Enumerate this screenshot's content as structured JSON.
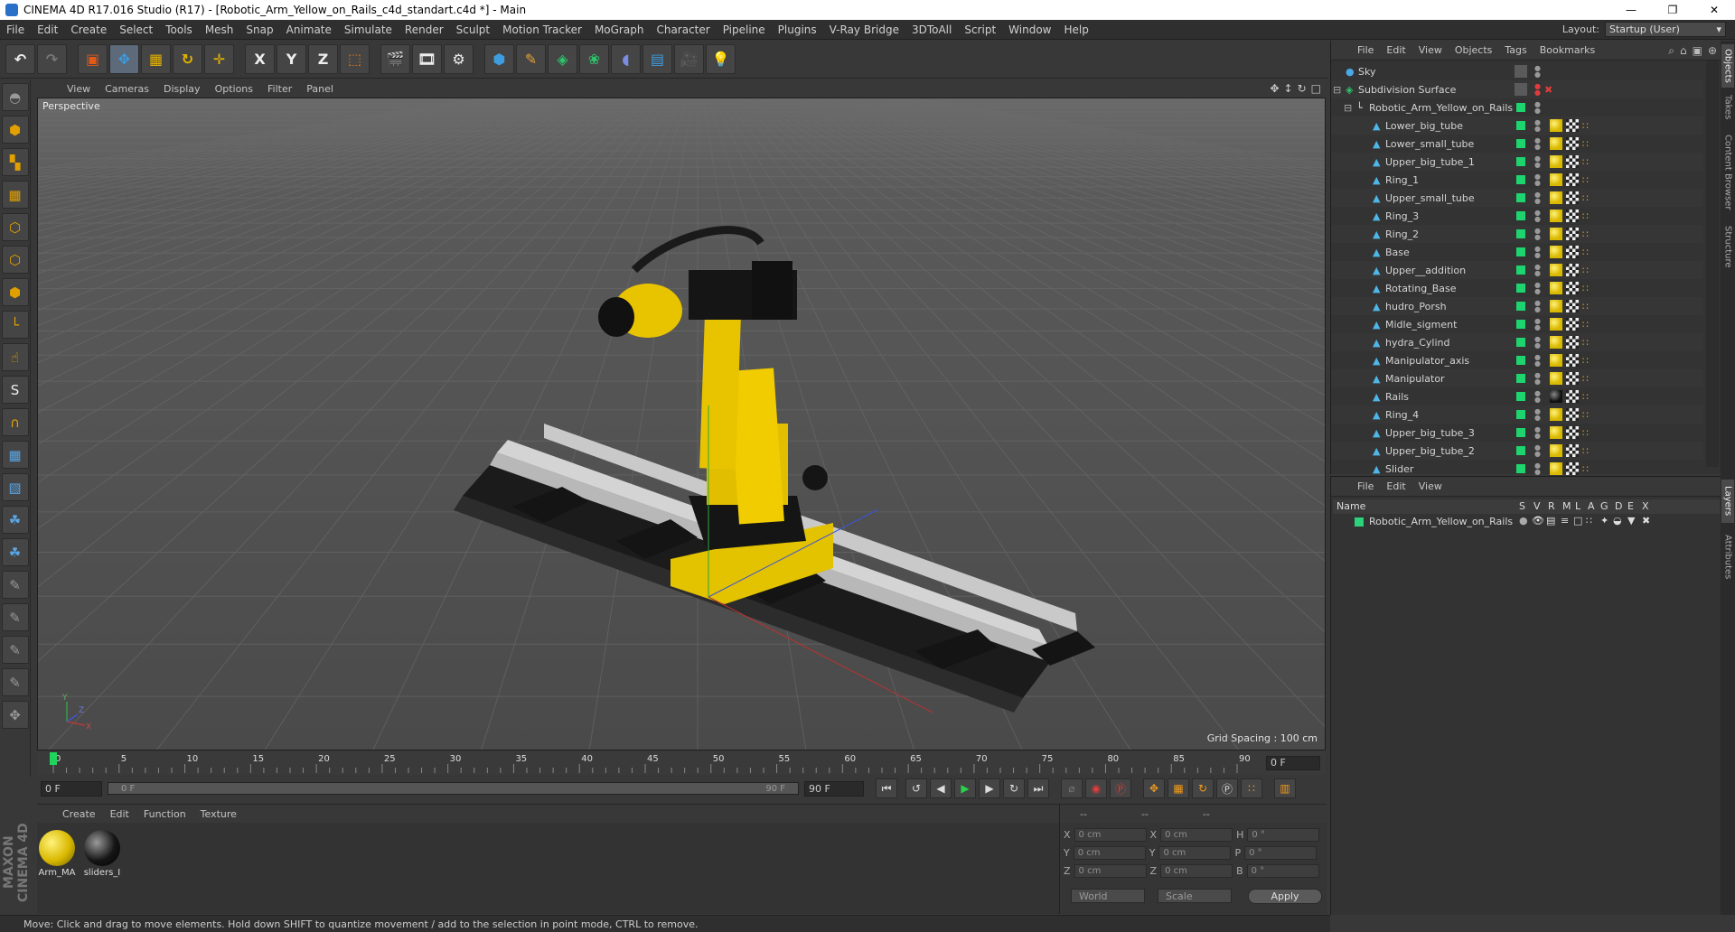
{
  "window": {
    "title": "CINEMA 4D R17.016 Studio (R17) - [Robotic_Arm_Yellow_on_Rails_c4d_standart.c4d *] - Main",
    "controls": [
      "minimize-icon",
      "maximize-icon",
      "close-icon"
    ]
  },
  "menu": {
    "items": [
      "File",
      "Edit",
      "Create",
      "Select",
      "Tools",
      "Mesh",
      "Snap",
      "Animate",
      "Simulate",
      "Render",
      "Sculpt",
      "Motion Tracker",
      "MoGraph",
      "Character",
      "Pipeline",
      "Plugins",
      "V-Ray Bridge",
      "3DToAll",
      "Script",
      "Window",
      "Help"
    ],
    "layout_label": "Layout:",
    "layout_value": "Startup (User)"
  },
  "toolbar": {
    "icons": [
      "undo-icon",
      "redo-icon",
      "live-selection-icon",
      "move-icon",
      "scale-icon",
      "rotate-icon",
      "transform-icon",
      "x-axis-icon",
      "y-axis-icon",
      "z-axis-icon",
      "coordinate-system-icon",
      "render-view-icon",
      "render-picture-viewer-icon",
      "edit-render-settings-icon",
      "cube-icon",
      "pen-icon",
      "subdivision-icon",
      "mograph-cloner-icon",
      "deformer-icon",
      "floor-icon",
      "camera-icon",
      "light-icon"
    ],
    "axis_labels": [
      "X",
      "Y",
      "Z"
    ]
  },
  "left_tools": [
    "make-editable-icon",
    "model-mode-icon",
    "texture-mode-icon",
    "workplane-icon",
    "points-mode-icon",
    "edges-mode-icon",
    "polygons-mode-icon",
    "axis-mode-icon",
    "tweak-icon",
    "solo-icon",
    "snap-magnet-icon",
    "grid-snap-icon",
    "soft-selection-icon",
    "python-icon",
    "python-2-icon",
    "sculpt-brush-icon",
    "sculpt-pull-icon",
    "sculpt-smooth-icon",
    "sculpt-inflate-icon",
    "sculpt-grab-icon"
  ],
  "viewport": {
    "menu": [
      "View",
      "Cameras",
      "Display",
      "Options",
      "Filter",
      "Panel"
    ],
    "camera_label": "Perspective",
    "grid_spacing": "Grid Spacing : 100 cm",
    "axis_labels": {
      "y": "Y",
      "x": "X",
      "z": "Z"
    }
  },
  "timeline": {
    "ticks": [
      "0",
      "5",
      "10",
      "15",
      "20",
      "25",
      "30",
      "35",
      "40",
      "45",
      "50",
      "55",
      "60",
      "65",
      "70",
      "75",
      "80",
      "85",
      "90"
    ],
    "current_frame": "0 F",
    "current_frame_box": "0 F"
  },
  "transport": {
    "start_field": "0 F",
    "range_start": "0 F",
    "range_end": "90 F",
    "end_field": "90 F"
  },
  "material_manager": {
    "menu": [
      "Create",
      "Edit",
      "Function",
      "Texture"
    ],
    "materials": [
      {
        "name": "Arm_MA",
        "color": "#d9b800"
      },
      {
        "name": "sliders_I",
        "color": "#111111"
      }
    ]
  },
  "coordinates": {
    "headers": [
      "--",
      "--",
      "--"
    ],
    "rows": [
      {
        "axis": "X",
        "pos": "0 cm",
        "axis2": "X",
        "size": "0 cm",
        "rot_label": "H",
        "rot": "0 °"
      },
      {
        "axis": "Y",
        "pos": "0 cm",
        "axis2": "Y",
        "size": "0 cm",
        "rot_label": "P",
        "rot": "0 °"
      },
      {
        "axis": "Z",
        "pos": "0 cm",
        "axis2": "Z",
        "size": "0 cm",
        "rot_label": "B",
        "rot": "0 °"
      }
    ],
    "mode_select": "World",
    "size_select": "Scale",
    "apply_label": "Apply"
  },
  "status": {
    "text": "Move: Click and drag to move elements. Hold down SHIFT to quantize movement / add to the selection in point mode, CTRL to remove."
  },
  "object_manager": {
    "menu": [
      "File",
      "Edit",
      "View",
      "Objects",
      "Tags",
      "Bookmarks"
    ],
    "objects": [
      {
        "name": "Sky",
        "level": 0
      },
      {
        "name": "Subdivision Surface",
        "level": 0
      },
      {
        "name": "Robotic_Arm_Yellow_on_Rails",
        "level": 1
      },
      {
        "name": "Lower_big_tube",
        "level": 2
      },
      {
        "name": "Lower_small_tube",
        "level": 2
      },
      {
        "name": "Upper_big_tube_1",
        "level": 2
      },
      {
        "name": "Ring_1",
        "level": 2
      },
      {
        "name": "Upper_small_tube",
        "level": 2
      },
      {
        "name": "Ring_3",
        "level": 2
      },
      {
        "name": "Ring_2",
        "level": 2
      },
      {
        "name": "Base",
        "level": 2
      },
      {
        "name": "Upper__addition",
        "level": 2
      },
      {
        "name": "Rotating_Base",
        "level": 2
      },
      {
        "name": "hudro_Porsh",
        "level": 2
      },
      {
        "name": "Midle_sigment",
        "level": 2
      },
      {
        "name": "hydra_Cylind",
        "level": 2
      },
      {
        "name": "Manipulator_axis",
        "level": 2
      },
      {
        "name": "Manipulator",
        "level": 2
      },
      {
        "name": "Rails",
        "level": 2
      },
      {
        "name": "Ring_4",
        "level": 2
      },
      {
        "name": "Upper_big_tube_3",
        "level": 2
      },
      {
        "name": "Upper_big_tube_2",
        "level": 2
      },
      {
        "name": "Slider",
        "level": 2
      }
    ]
  },
  "layer_manager": {
    "menu": [
      "File",
      "Edit",
      "View"
    ],
    "columns": [
      "Name",
      "S",
      "V",
      "R",
      "M",
      "L",
      "A",
      "G",
      "D",
      "E",
      "X"
    ],
    "layers": [
      {
        "name": "Robotic_Arm_Yellow_on_Rails",
        "color": "#2bd37a"
      }
    ]
  },
  "side_tabs": [
    "Objects",
    "Takes",
    "Content Browser",
    "Structure",
    "Layers",
    "Attributes"
  ]
}
